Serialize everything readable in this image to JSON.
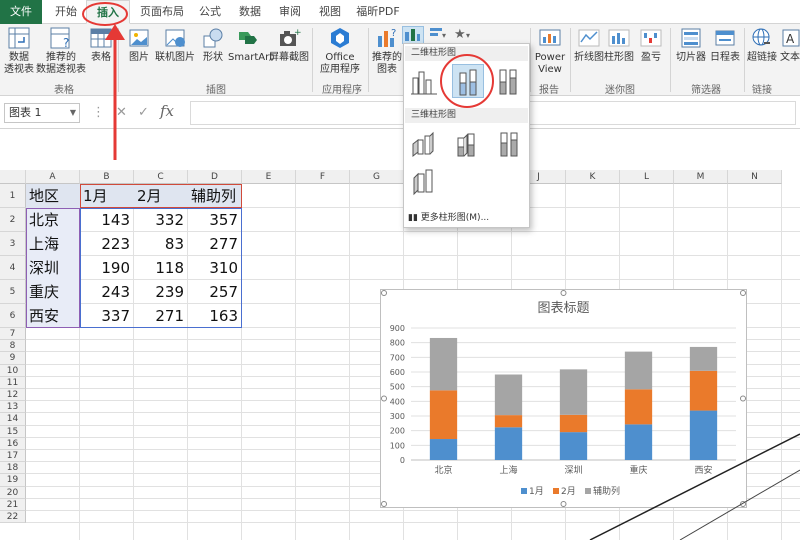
{
  "menu": {
    "tabs": [
      "文件",
      "开始",
      "插入",
      "页面布局",
      "公式",
      "数据",
      "审阅",
      "视图",
      "福昕PDF"
    ],
    "active": "插入"
  },
  "ribbon": {
    "buttons": {
      "pivot": "数据\n透视表",
      "recommended_pivot": "推荐的\n数据透视表",
      "table": "表格",
      "picture": "图片",
      "online_picture": "联机图片",
      "shapes": "形状",
      "smartart": "SmartArt",
      "screenshot": "屏幕截图",
      "office_apps": "Office\n应用程序",
      "recommended_charts": "推荐的\n图表",
      "power_view": "Power\nView",
      "line_spark": "折线图",
      "column_spark": "柱形图",
      "winloss": "盈亏",
      "slicer": "切片器",
      "timeline": "日程表",
      "hyperlink": "超链接",
      "text": "文本"
    },
    "groups": {
      "tables": "表格",
      "illustrations": "插图",
      "apps": "应用程序",
      "reports": "报告",
      "sparklines": "迷你图",
      "filters": "筛选器",
      "links": "链接"
    }
  },
  "formula_bar": {
    "name_box": "图表 1",
    "fx": "fx",
    "value": ""
  },
  "sheet": {
    "columns": [
      "A",
      "B",
      "C",
      "D",
      "E",
      "F",
      "G",
      "H",
      "I",
      "J",
      "K",
      "L",
      "M",
      "N"
    ],
    "rows": [
      "1",
      "2",
      "3",
      "4",
      "5",
      "6",
      "7",
      "8",
      "9",
      "10",
      "11",
      "12",
      "13",
      "14",
      "15",
      "16",
      "17",
      "18",
      "19",
      "20",
      "21",
      "22"
    ],
    "header": [
      "地区",
      "1月",
      "2月",
      "辅助列"
    ],
    "data": [
      [
        "北京",
        "143",
        "332",
        "357"
      ],
      [
        "上海",
        "223",
        "83",
        "277"
      ],
      [
        "深圳",
        "190",
        "118",
        "310"
      ],
      [
        "重庆",
        "243",
        "239",
        "257"
      ],
      [
        "西安",
        "337",
        "271",
        "163"
      ]
    ]
  },
  "dropdown": {
    "section_2d": "二维柱形图",
    "section_3d": "三维柱形图",
    "more": "更多柱形图(M)..."
  },
  "chart_data": {
    "type": "bar",
    "stacked": true,
    "title": "图表标题",
    "categories": [
      "北京",
      "上海",
      "深圳",
      "重庆",
      "西安"
    ],
    "series": [
      {
        "name": "1月",
        "values": [
          143,
          223,
          190,
          243,
          337
        ],
        "color": "#4e8fce"
      },
      {
        "name": "2月",
        "values": [
          332,
          83,
          118,
          239,
          271
        ],
        "color": "#ea7a2b"
      },
      {
        "name": "辅助列",
        "values": [
          357,
          277,
          310,
          257,
          163
        ],
        "color": "#a5a5a5"
      }
    ],
    "ylim": [
      0,
      900
    ],
    "yticks": [
      0,
      100,
      200,
      300,
      400,
      500,
      600,
      700,
      800,
      900
    ],
    "grid": true,
    "legend": "bottom"
  },
  "colors": {
    "accent": "#217346",
    "annotation": "#e53935",
    "highlight": "#b4c7e7"
  }
}
